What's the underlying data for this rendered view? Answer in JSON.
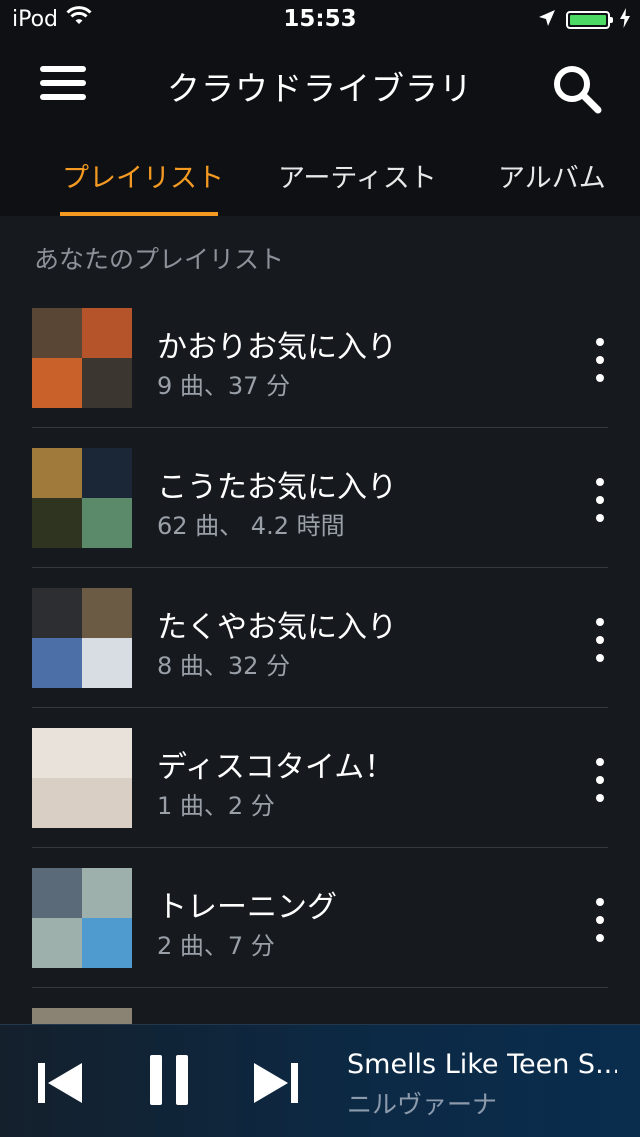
{
  "status": {
    "device": "iPod",
    "time": "15:53",
    "battery_color": "#4cd964"
  },
  "header": {
    "title": "クラウドライブラリ",
    "tabs": [
      {
        "label": "プレイリスト",
        "active": true
      },
      {
        "label": "アーティスト",
        "active": false
      },
      {
        "label": "アルバム",
        "active": false
      }
    ],
    "accent_color": "#f49a22"
  },
  "section": {
    "label": "あなたのプレイリスト"
  },
  "playlists": [
    {
      "title": "かおりお気に入り",
      "subtitle": "9 曲、37 分",
      "art": [
        "#5a4634",
        "#b5542a",
        "#c9622a",
        "#3b3630"
      ]
    },
    {
      "title": "こうたお気に入り",
      "subtitle": "62 曲、 4.2 時間",
      "art": [
        "#a07a3a",
        "#1b2636",
        "#2f3420",
        "#5b8a6a"
      ]
    },
    {
      "title": "たくやお気に入り",
      "subtitle": "8 曲、32 分",
      "art": [
        "#2c2e32",
        "#6b5a44",
        "#4d6fa8",
        "#d8dde4"
      ]
    },
    {
      "title": "ディスコタイム！",
      "subtitle": "1 曲、2 分",
      "art": [
        "#e9e2da",
        "#e9e2da",
        "#d9cfc4",
        "#d9cfc4"
      ]
    },
    {
      "title": "トレーニング",
      "subtitle": "2 曲、7 分",
      "art": [
        "#5a6a78",
        "#9eb0ac",
        "#9eb0ac",
        "#4f9bd0"
      ]
    }
  ],
  "player": {
    "track": "Smells Like Teen S...",
    "artist": "ニルヴァーナ"
  }
}
